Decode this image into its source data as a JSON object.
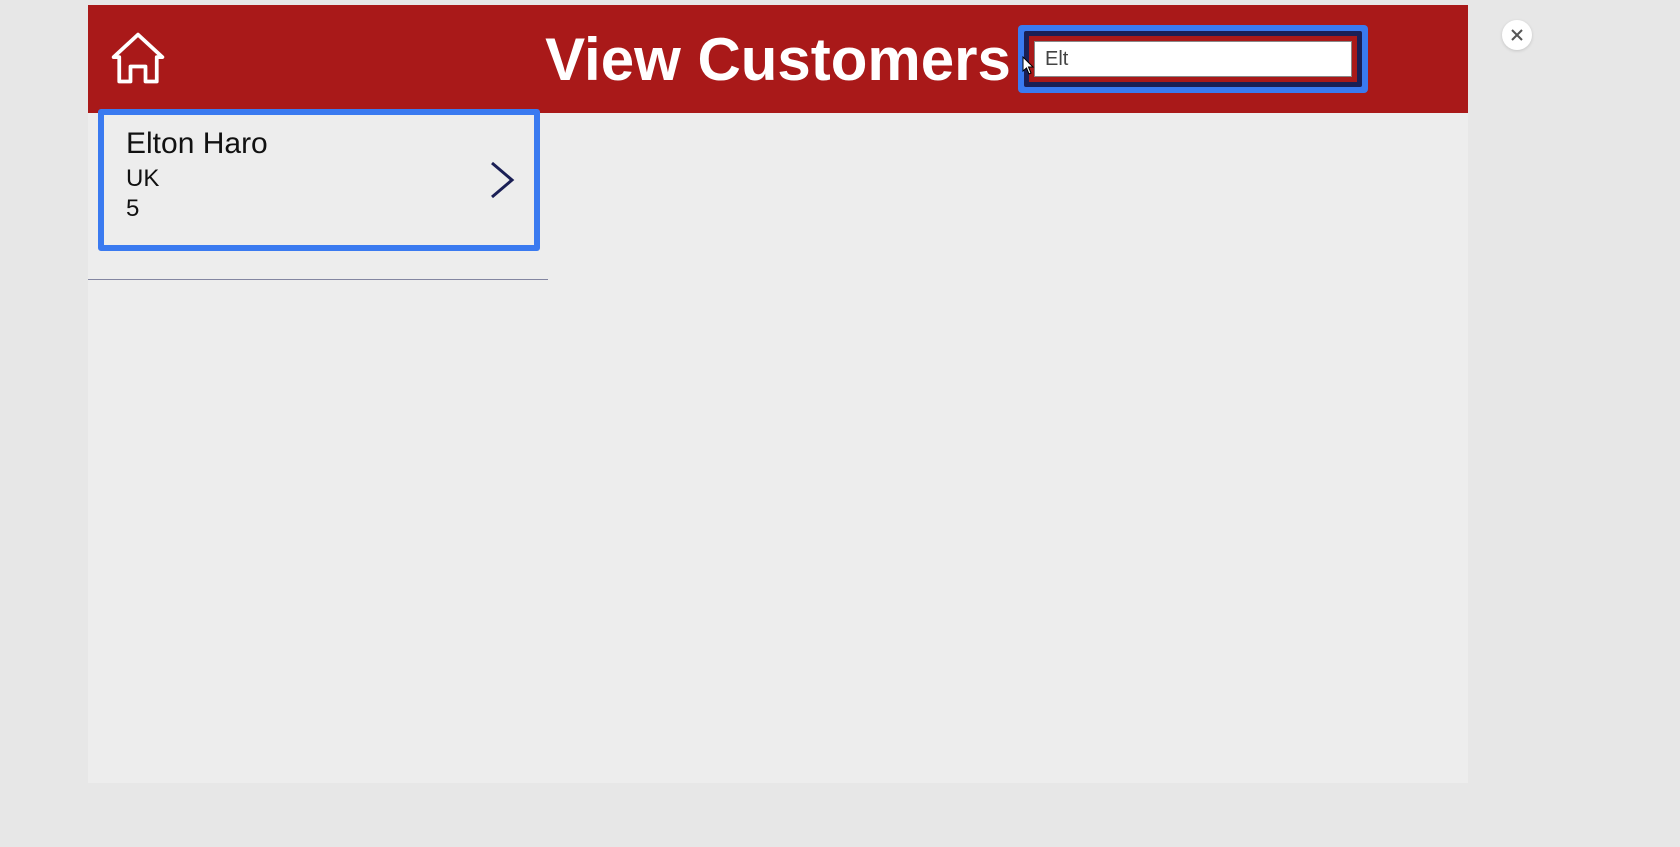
{
  "header": {
    "title": "View Customers"
  },
  "search": {
    "value": "Elt"
  },
  "customers": [
    {
      "name": "Elton  Haro",
      "country": "UK",
      "id": "5"
    }
  ]
}
